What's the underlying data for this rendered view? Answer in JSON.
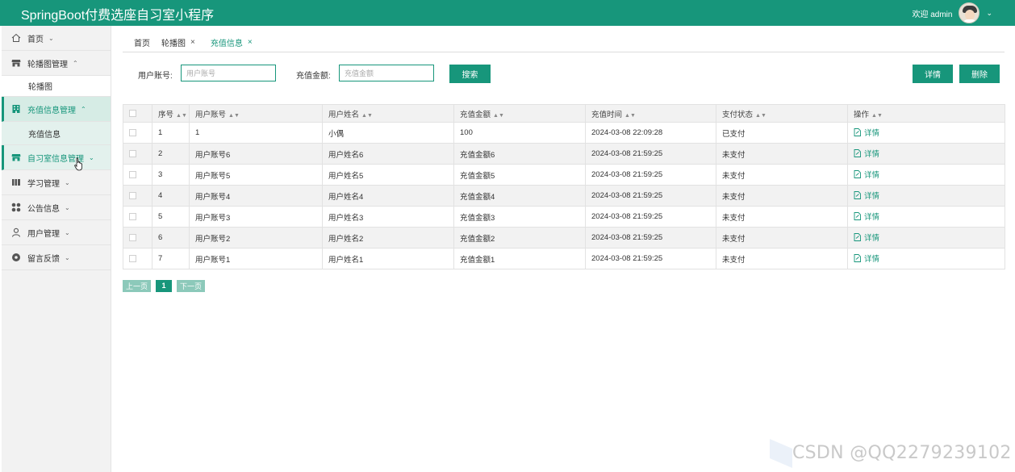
{
  "header": {
    "title": "SpringBoot付费选座自习室小程序",
    "welcome": "欢迎 admin"
  },
  "sidebar": {
    "items": [
      {
        "label": "首页",
        "icon": "home-icon"
      },
      {
        "label": "轮播图管理",
        "icon": "store-icon",
        "sub": "轮播图"
      },
      {
        "label": "充值信息管理",
        "icon": "building-icon",
        "sub": "充值信息"
      },
      {
        "label": "自习室信息管理",
        "icon": "store-icon"
      },
      {
        "label": "学习管理",
        "icon": "book-icon"
      },
      {
        "label": "公告信息",
        "icon": "grid-icon"
      },
      {
        "label": "用户管理",
        "icon": "user-icon"
      },
      {
        "label": "留言反馈",
        "icon": "message-icon"
      }
    ]
  },
  "tabs": [
    {
      "label": "首页"
    },
    {
      "label": "轮播图"
    },
    {
      "label": "充值信息"
    }
  ],
  "search": {
    "account_label": "用户账号:",
    "account_placeholder": "用户账号",
    "amount_label": "充值金额:",
    "amount_placeholder": "充值金额",
    "search_button": "搜索",
    "detail_button": "详情",
    "delete_button": "删除"
  },
  "table": {
    "columns": [
      "序号",
      "用户账号",
      "用户姓名",
      "充值金额",
      "充值时间",
      "支付状态",
      "操作"
    ],
    "rows": [
      {
        "no": "1",
        "account": "1",
        "name": "小偶",
        "amount": "100",
        "time": "2024-03-08 22:09:28",
        "status": "已支付",
        "action": "详情"
      },
      {
        "no": "2",
        "account": "用户账号6",
        "name": "用户姓名6",
        "amount": "充值金额6",
        "time": "2024-03-08 21:59:25",
        "status": "未支付",
        "action": "详情"
      },
      {
        "no": "3",
        "account": "用户账号5",
        "name": "用户姓名5",
        "amount": "充值金额5",
        "time": "2024-03-08 21:59:25",
        "status": "未支付",
        "action": "详情"
      },
      {
        "no": "4",
        "account": "用户账号4",
        "name": "用户姓名4",
        "amount": "充值金额4",
        "time": "2024-03-08 21:59:25",
        "status": "未支付",
        "action": "详情"
      },
      {
        "no": "5",
        "account": "用户账号3",
        "name": "用户姓名3",
        "amount": "充值金额3",
        "time": "2024-03-08 21:59:25",
        "status": "未支付",
        "action": "详情"
      },
      {
        "no": "6",
        "account": "用户账号2",
        "name": "用户姓名2",
        "amount": "充值金额2",
        "time": "2024-03-08 21:59:25",
        "status": "未支付",
        "action": "详情"
      },
      {
        "no": "7",
        "account": "用户账号1",
        "name": "用户姓名1",
        "amount": "充值金额1",
        "time": "2024-03-08 21:59:25",
        "status": "未支付",
        "action": "详情"
      }
    ]
  },
  "pagination": {
    "prev": "上一页",
    "current": "1",
    "next": "下一页"
  },
  "watermark": "CSDN @QQ2279239102",
  "colors": {
    "accent": "#17967b",
    "sidebar_bg": "#f2f2f2",
    "disabled": "#8cc9ba"
  }
}
